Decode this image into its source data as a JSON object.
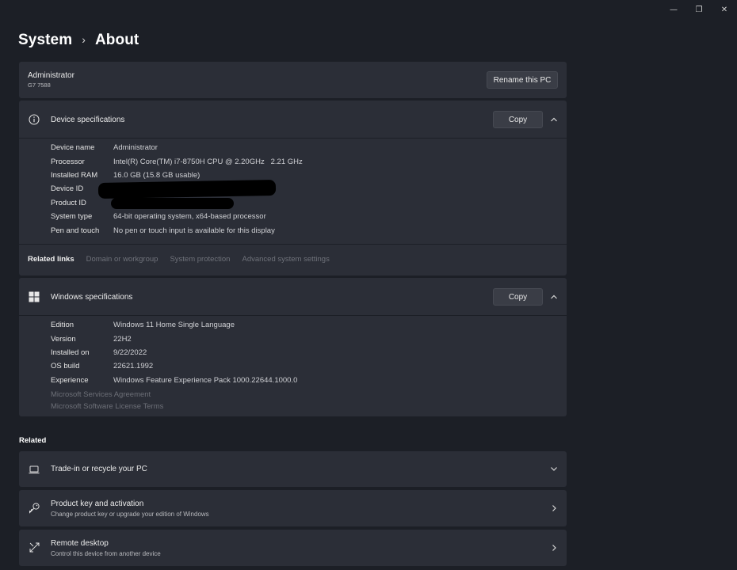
{
  "window_controls": {
    "minimize": "—",
    "maximize": "❐",
    "close": "✕"
  },
  "breadcrumb": {
    "parent": "System",
    "separator": "›",
    "current": "About"
  },
  "pc": {
    "name": "Administrator",
    "model": "G7 7588",
    "rename_label": "Rename this PC"
  },
  "device_specs": {
    "title": "Device specifications",
    "copy_label": "Copy",
    "rows": [
      {
        "key": "Device name",
        "value": "Administrator"
      },
      {
        "key": "Processor",
        "value": "Intel(R) Core(TM) i7-8750H CPU @ 2.20GHz   2.21 GHz"
      },
      {
        "key": "Installed RAM",
        "value": "16.0 GB (15.8 GB usable)"
      },
      {
        "key": "Device ID",
        "value": ""
      },
      {
        "key": "Product ID",
        "value": ""
      },
      {
        "key": "System type",
        "value": "64-bit operating system, x64-based processor"
      },
      {
        "key": "Pen and touch",
        "value": "No pen or touch input is available for this display"
      }
    ]
  },
  "related_links": {
    "label": "Related links",
    "links": [
      "Domain or workgroup",
      "System protection",
      "Advanced system settings"
    ]
  },
  "windows_specs": {
    "title": "Windows specifications",
    "copy_label": "Copy",
    "rows": [
      {
        "key": "Edition",
        "value": "Windows 11 Home Single Language"
      },
      {
        "key": "Version",
        "value": "22H2"
      },
      {
        "key": "Installed on",
        "value": "9/22/2022"
      },
      {
        "key": "OS build",
        "value": "22621.1992"
      },
      {
        "key": "Experience",
        "value": "Windows Feature Experience Pack 1000.22644.1000.0"
      }
    ],
    "agreement_links": [
      "Microsoft Services Agreement",
      "Microsoft Software License Terms"
    ]
  },
  "related": {
    "title": "Related",
    "items": [
      {
        "title": "Trade-in or recycle your PC",
        "subtitle": "",
        "icon": "laptop-icon"
      },
      {
        "title": "Product key and activation",
        "subtitle": "Change product key or upgrade your edition of Windows",
        "icon": "key-icon"
      },
      {
        "title": "Remote desktop",
        "subtitle": "Control this device from another device",
        "icon": "remote-desktop-icon"
      }
    ]
  }
}
